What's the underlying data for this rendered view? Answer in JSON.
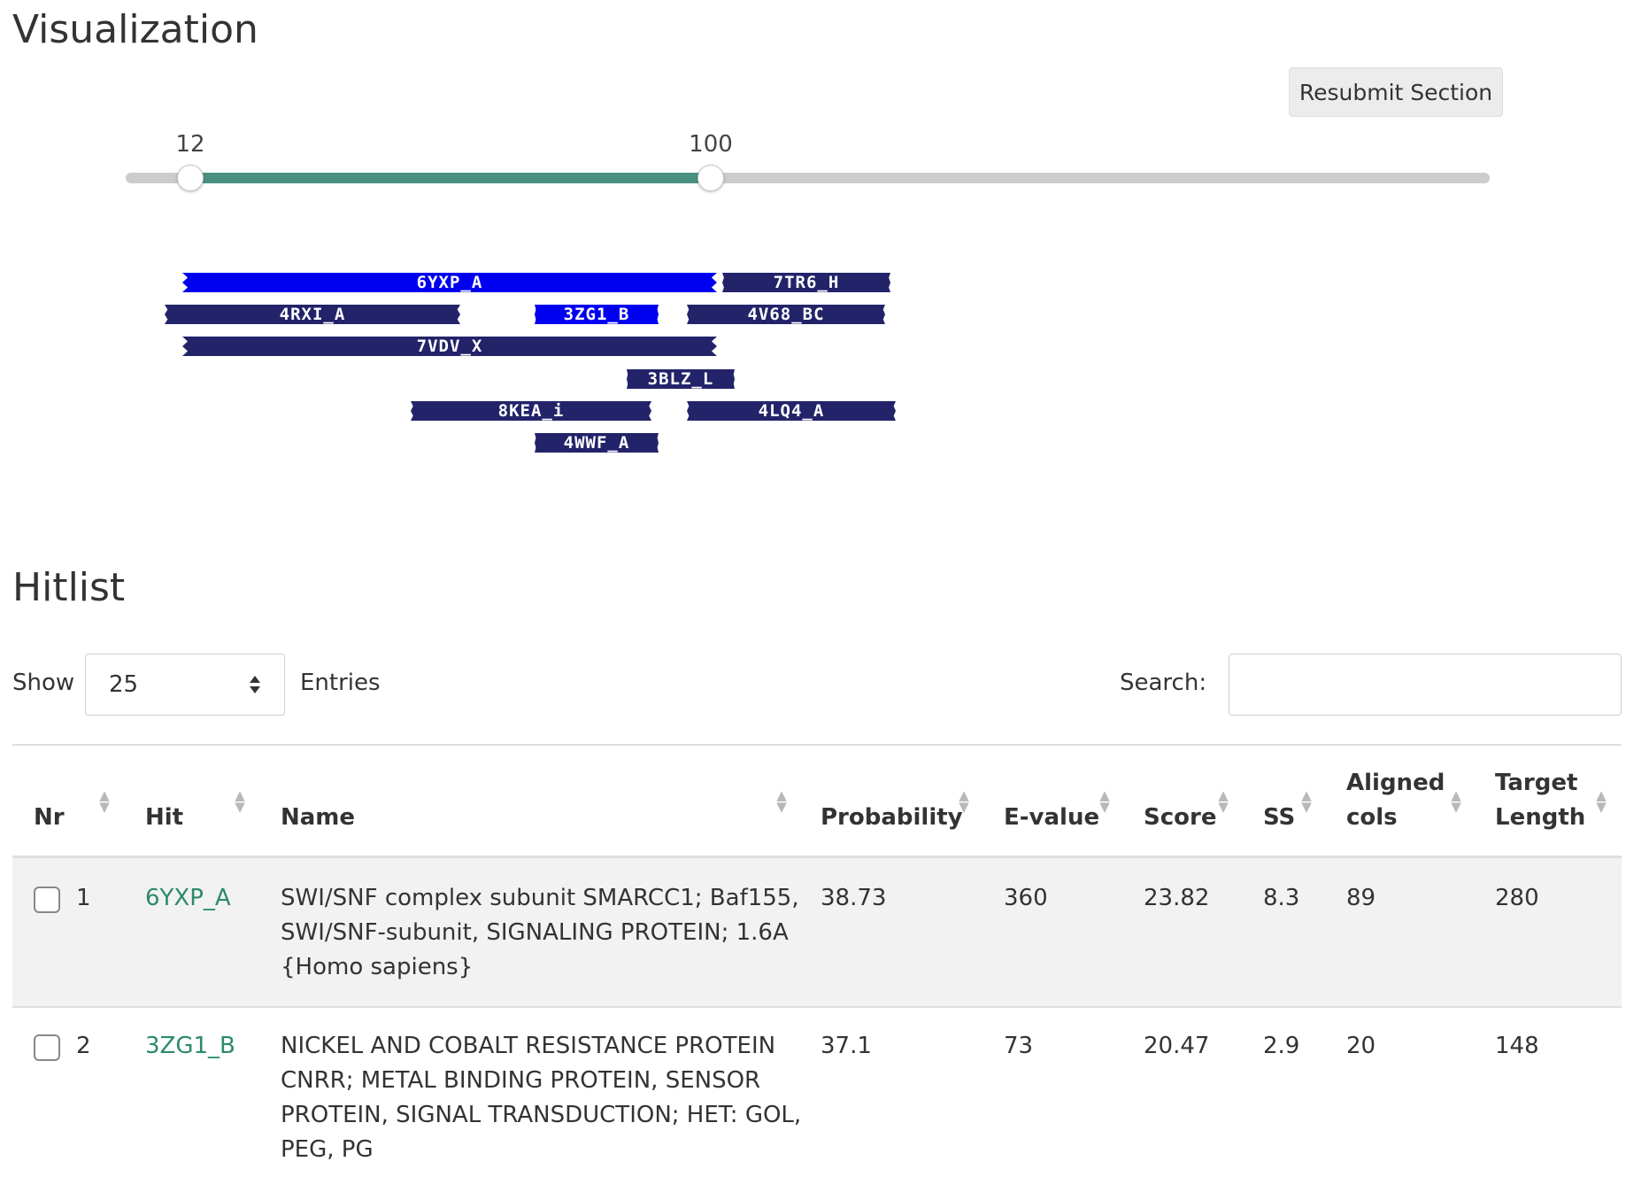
{
  "visualization": {
    "title": "Visualization",
    "resubmit_label": "Resubmit Section",
    "range_start": 12,
    "range_end": 100,
    "range_min": 1,
    "range_max": 272
  },
  "hit_bars": [
    {
      "label": "6YXP_A",
      "color": "#0000f0"
    },
    {
      "label": "7TR6_H",
      "color": "#23236a"
    },
    {
      "label": "4RXI_A",
      "color": "#23236a"
    },
    {
      "label": "3ZG1_B",
      "color": "#0000f0"
    },
    {
      "label": "4V68_BC",
      "color": "#23236a"
    },
    {
      "label": "7VDV_X",
      "color": "#23236a"
    },
    {
      "label": "3BLZ_L",
      "color": "#23236a"
    },
    {
      "label": "8KEA_i",
      "color": "#23236a"
    },
    {
      "label": "4LQ4_A",
      "color": "#23236a"
    },
    {
      "label": "4WWF_A",
      "color": "#23236a"
    }
  ],
  "hitlist": {
    "title": "Hitlist",
    "show_label": "Show",
    "entries_value": "25",
    "entries_label": "Entries",
    "search_label": "Search:",
    "search_value": "",
    "columns": [
      {
        "line1": "",
        "line2": "Nr"
      },
      {
        "line1": "",
        "line2": "Hit"
      },
      {
        "line1": "",
        "line2": "Name"
      },
      {
        "line1": "",
        "line2": "Probability"
      },
      {
        "line1": "",
        "line2": "E-value"
      },
      {
        "line1": "",
        "line2": "Score"
      },
      {
        "line1": "",
        "line2": "SS"
      },
      {
        "line1": "Aligned",
        "line2": "cols"
      },
      {
        "line1": "Target",
        "line2": "Length"
      }
    ],
    "rows": [
      {
        "nr": "1",
        "hit": "6YXP_A",
        "name_lines": [
          "SWI/SNF complex subunit SMARCC1; Baf155,",
          "SWI/SNF-subunit, SIGNALING PROTEIN; 1.6A",
          "{Homo sapiens}"
        ],
        "probability": "38.73",
        "evalue": "360",
        "score": "23.82",
        "ss": "8.3",
        "aligned_cols": "89",
        "target_length": "280"
      },
      {
        "nr": "2",
        "hit": "3ZG1_B",
        "name_lines": [
          "NICKEL AND COBALT RESISTANCE PROTEIN",
          "CNRR; METAL BINDING PROTEIN, SENSOR",
          "PROTEIN, SIGNAL TRANSDUCTION; HET: GOL,",
          "PEG, PG"
        ],
        "probability": "37.1",
        "evalue": "73",
        "score": "20.47",
        "ss": "2.9",
        "aligned_cols": "20",
        "target_length": "148"
      }
    ]
  }
}
